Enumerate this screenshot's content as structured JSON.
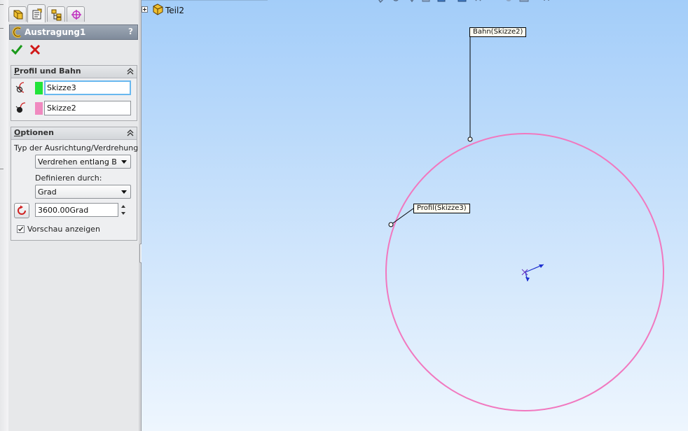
{
  "tabs": [
    {
      "name": "featuremanager",
      "icon": "feature-tree-icon"
    },
    {
      "name": "propertymanager",
      "icon": "property-manager-icon",
      "active": true
    },
    {
      "name": "configurationmanager",
      "icon": "configuration-icon"
    },
    {
      "name": "dimxpertmanager",
      "icon": "dimxpert-icon"
    }
  ],
  "feature": {
    "title": "Austragung1",
    "help": "?",
    "icon": "sweep-feature-icon"
  },
  "actions": {
    "ok_icon": "checkmark-icon",
    "cancel_icon": "cancel-x-icon"
  },
  "profile_group": {
    "title_accel": "P",
    "title_rest": "rofil und Bahn",
    "profile": {
      "value": "Skizze3",
      "color": "#22e33a",
      "icon": "profile-selection-icon"
    },
    "path": {
      "value": "Skizze2",
      "color": "#f08ac0",
      "icon": "path-selection-icon"
    }
  },
  "options_group": {
    "title_accel": "O",
    "title_rest": "ptionen",
    "orientation_label": "Typ der Ausrichtung/Verdrehung:",
    "orientation_value": "Verdrehen entlang Bahn",
    "define_label": "Definieren durch:",
    "define_value": "Grad",
    "angle_value": "3600.00Grad",
    "reverse_icon": "reverse-direction-icon",
    "preview_label": "Vorschau anzeigen",
    "preview_checked": true
  },
  "graphics": {
    "tree_root": "Teil2",
    "part_icon": "part-icon",
    "callout_path": "Bahn(Skizze2)",
    "callout_profile": "Profil(Skizze3)",
    "path_color": "#f178bf",
    "triad_icon": "coordinate-triad-icon"
  }
}
